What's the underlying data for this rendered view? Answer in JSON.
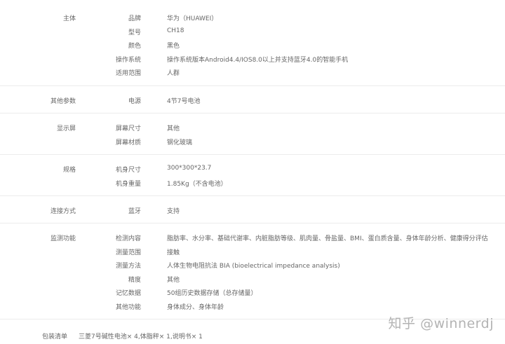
{
  "sections": [
    {
      "category": "主体",
      "rows": [
        {
          "key": "品牌",
          "value": "华为（HUAWEI）"
        },
        {
          "key": "型号",
          "value": "CH18"
        },
        {
          "key": "颜色",
          "value": "黑色"
        },
        {
          "key": "操作系统",
          "value": "操作系统版本Android4.4/IOS8.0以上并支持蓝牙4.0的智能手机"
        },
        {
          "key": "适用范围",
          "value": "人群"
        }
      ]
    },
    {
      "category": "其他参数",
      "rows": [
        {
          "key": "电源",
          "value": "4节7号电池"
        }
      ]
    },
    {
      "category": "显示屏",
      "rows": [
        {
          "key": "屏幕尺寸",
          "value": "其他"
        },
        {
          "key": "屏幕材质",
          "value": "钢化玻璃"
        }
      ]
    },
    {
      "category": "规格",
      "rows": [
        {
          "key": "机身尺寸",
          "value": "300*300*23.7"
        },
        {
          "key": "机身重量",
          "value": "1.85Kg（不含电池）"
        }
      ]
    },
    {
      "category": "连接方式",
      "rows": [
        {
          "key": "蓝牙",
          "value": "支持"
        }
      ]
    },
    {
      "category": "监测功能",
      "rows": [
        {
          "key": "检测内容",
          "value": "脂肪率、水分率、基础代谢率、内脏脂肪等级、肌肉量、骨盐量、BMI、蛋白质含量、身体年龄分析、健康得分评估"
        },
        {
          "key": "测量范围",
          "value": "接触"
        },
        {
          "key": "测量方法",
          "value": "人体生物电阻抗法 BIA (bioelectrical impedance analysis)"
        },
        {
          "key": "精度",
          "value": "其他"
        },
        {
          "key": "记忆数据",
          "value": "50组历史数据存储（总存储量）"
        },
        {
          "key": "其他功能",
          "value": "身体成分、身体年龄"
        }
      ]
    }
  ],
  "packing": {
    "label": "包装清单",
    "value": "三菱7号碱性电池× 4,体脂秤× 1,说明书× 1"
  },
  "watermark": "知乎 @winnerdj"
}
